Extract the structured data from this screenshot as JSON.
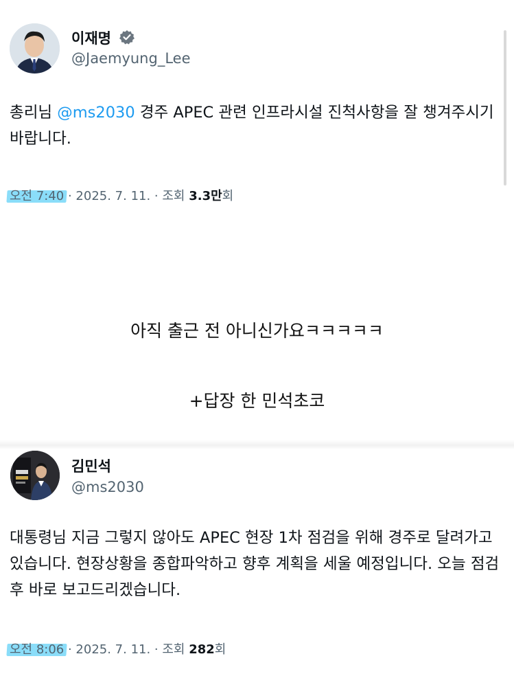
{
  "tweet1": {
    "display_name": "이재명",
    "handle": "@Jaemyung_Lee",
    "text_before": "총리님 ",
    "mention": "@ms2030",
    "text_after": " 경주 APEC 관련 인프라시설 진척사항을 잘 챙겨주시기 바랍니다.",
    "time": "오전 7:40",
    "date": " · 2025. 7. 11. · 조회 ",
    "views_bold": "3.3만",
    "views_suffix": "회",
    "verified_icon": "verified-badge-icon"
  },
  "caption": {
    "line1": "아직 출근 전 아니신가요ㅋㅋㅋㅋㅋ",
    "line2": "+답장 한 민석초코"
  },
  "tweet2": {
    "display_name": "김민석",
    "handle": "@ms2030",
    "text": "대통령님 지금 그렇지 않아도 APEC 현장 1차 점검을 위해 경주로 달려가고 있습니다. 현장상황을 종합파악하고 향후 계획을 세울 예정입니다. 오늘 점검 후 바로 보고드리겠습니다.",
    "time": "오전 8:06",
    "date": " · 2025. 7. 11. · 조회 ",
    "views_bold": "282",
    "views_suffix": "회"
  },
  "colors": {
    "mention": "#1d9bf0",
    "secondary_text": "#536471",
    "highlight": "#63d2f7"
  }
}
